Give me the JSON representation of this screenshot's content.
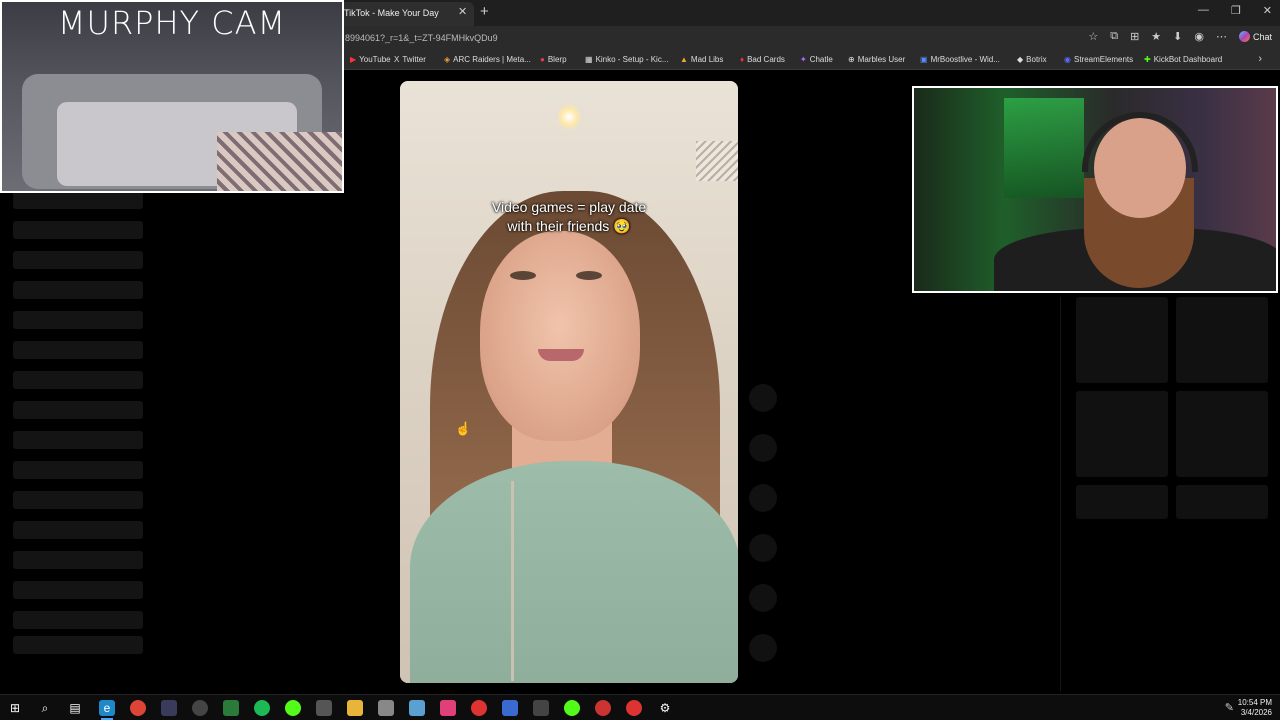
{
  "browser": {
    "tab_title": "TikTok - Make Your Day",
    "tab_close": "✕",
    "new_tab": "+",
    "url": "8994061?_r=1&_t=ZT-94FMHkvQDu9",
    "window_controls": [
      "—",
      "❐",
      "✕"
    ],
    "chat_label": "Chat",
    "bookmarks": [
      {
        "label": "YouTube",
        "icon": "▶"
      },
      {
        "label": "Twitter",
        "icon": "X"
      },
      {
        "label": "ARC Raiders | Meta...",
        "icon": "◈"
      },
      {
        "label": "Blerp",
        "icon": "●"
      },
      {
        "label": "Kinko - Setup - Kic...",
        "icon": "▦"
      },
      {
        "label": "Mad Libs",
        "icon": "▲"
      },
      {
        "label": "Bad Cards",
        "icon": "♦"
      },
      {
        "label": "Chatle",
        "icon": "✦"
      },
      {
        "label": "Marbles User",
        "icon": "⊕"
      },
      {
        "label": "MrBoostlive - Wid...",
        "icon": "▣"
      },
      {
        "label": "Botrix",
        "icon": "◆"
      },
      {
        "label": "StreamElements",
        "icon": "◉"
      },
      {
        "label": "KickBot Dashboard",
        "icon": "✚"
      }
    ],
    "bookmarks_more": "›"
  },
  "video": {
    "caption_line1": "Video games = play date",
    "caption_line2": "with their friends 🥹"
  },
  "overlay": {
    "murphy_cam_title": "MURPHY CAM"
  },
  "taskbar": {
    "time": "10:54 PM",
    "date": "3/4/2026",
    "icons": [
      "windows-start",
      "search",
      "task-view",
      "edge",
      "chrome",
      "app-1",
      "app-2",
      "app-3",
      "spotify",
      "app-4",
      "app-5",
      "file-explorer",
      "app-6",
      "app-7",
      "app-8",
      "app-9",
      "app-10",
      "app-11",
      "app-12",
      "app-13",
      "app-14",
      "app-15",
      "settings"
    ]
  }
}
